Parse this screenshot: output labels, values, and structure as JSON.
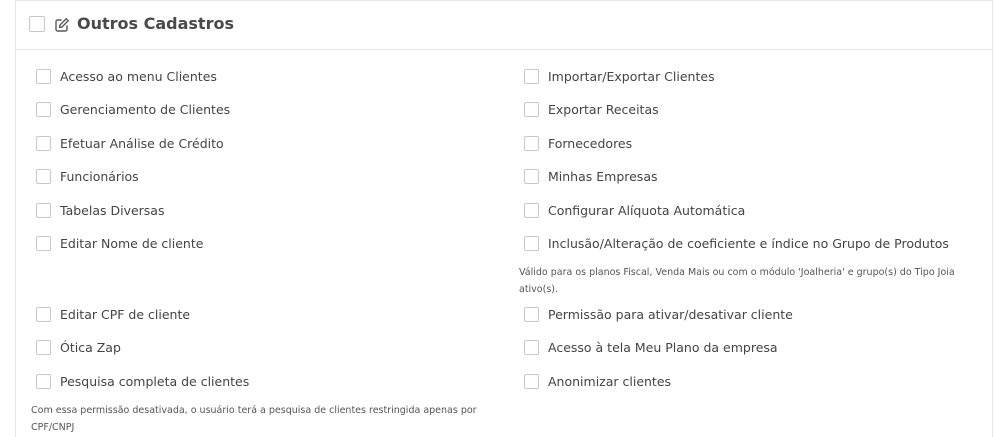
{
  "section": {
    "title": "Outros Cadastros",
    "icon": "edit-icon"
  },
  "left_items": [
    {
      "label": "Acesso ao menu Clientes"
    },
    {
      "label": "Gerenciamento de Clientes"
    },
    {
      "label": "Efetuar Análise de Crédito"
    },
    {
      "label": "Funcionários"
    },
    {
      "label": "Tabelas Diversas"
    },
    {
      "label": "Editar Nome de cliente"
    },
    {
      "label": "Editar CPF de cliente"
    },
    {
      "label": "Ótica Zap"
    },
    {
      "label": "Pesquisa completa de clientes",
      "note": "Com essa permissão desativada, o usuário terá a pesquisa de clientes restringida apenas por CPF/CNPJ"
    }
  ],
  "right_items": [
    {
      "label": "Importar/Exportar Clientes"
    },
    {
      "label": "Exportar Receitas"
    },
    {
      "label": "Fornecedores"
    },
    {
      "label": "Minhas Empresas"
    },
    {
      "label": "Configurar Alíquota Automática"
    },
    {
      "label": "Inclusão/Alteração de coeficiente e índice no Grupo de Produtos",
      "note": "Válido para os planos Fiscal, Venda Mais ou com o módulo 'Joalheria' e grupo(s) do Tipo Joia ativo(s)."
    },
    {
      "label": "Permissão para ativar/desativar cliente"
    },
    {
      "label": "Acesso à tela Meu Plano da empresa"
    },
    {
      "label": "Anonimizar clientes"
    }
  ]
}
